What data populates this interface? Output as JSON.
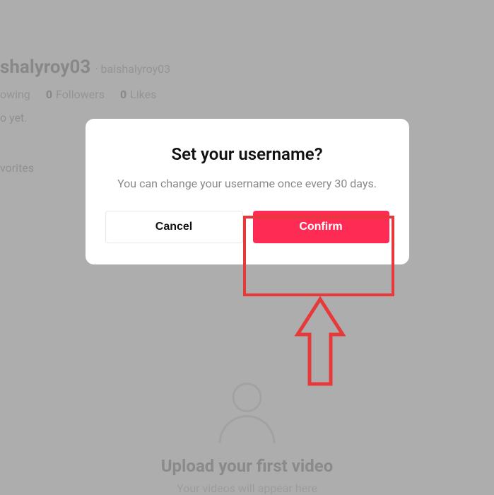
{
  "profile": {
    "display_name_partial": "shalyroy03",
    "username_prefix": "· baishalyroy03",
    "following_label_partial": "owing",
    "followers_count": "0",
    "followers_label": "Followers",
    "likes_count": "0",
    "likes_label": "Likes",
    "bio_partial": "o yet.",
    "favorites_partial": "vorites"
  },
  "empty_state": {
    "title": "Upload your first video",
    "subtitle": "Your videos will appear here"
  },
  "modal": {
    "title": "Set your username?",
    "body": "You can change your username once every 30 days.",
    "cancel_label": "Cancel",
    "confirm_label": "Confirm"
  }
}
